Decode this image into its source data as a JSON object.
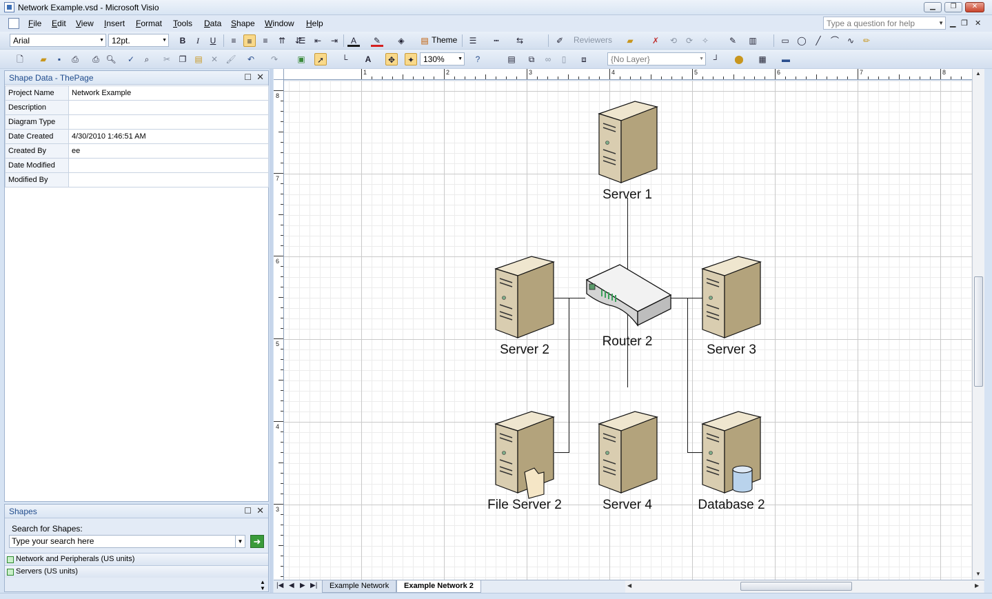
{
  "window": {
    "title": "Network Example.vsd - Microsoft Visio",
    "controls": {
      "minimize": "▁",
      "restore": "❐",
      "close": "✕"
    }
  },
  "menubar": {
    "items": [
      "File",
      "Edit",
      "View",
      "Insert",
      "Format",
      "Tools",
      "Data",
      "Shape",
      "Window",
      "Help"
    ],
    "help_placeholder": "Type a question for help"
  },
  "toolbar1": {
    "font": "Arial",
    "font_size": "12pt.",
    "theme_label": "Theme",
    "reviewers_label": "Reviewers"
  },
  "toolbar2": {
    "zoom": "130%",
    "layer": "{No Layer}"
  },
  "shape_data": {
    "title": "Shape Data - ThePage",
    "rows": [
      {
        "key": "Project Name",
        "value": "Network Example"
      },
      {
        "key": "Description",
        "value": ""
      },
      {
        "key": "Diagram Type",
        "value": ""
      },
      {
        "key": "Date Created",
        "value": "4/30/2010 1:46:51 AM"
      },
      {
        "key": "Created By",
        "value": "ee"
      },
      {
        "key": "Date Modified",
        "value": ""
      },
      {
        "key": "Modified By",
        "value": ""
      }
    ]
  },
  "shapes_panel": {
    "title": "Shapes",
    "search_label": "Search for Shapes:",
    "search_placeholder": "Type your search here",
    "stencils": [
      "Network and Peripherals (US units)",
      "Servers (US units)"
    ]
  },
  "rulers": {
    "top_labels": [
      "1",
      "2",
      "3",
      "4",
      "5",
      "6",
      "7",
      "8"
    ],
    "left_labels": [
      "8",
      "7",
      "6",
      "5",
      "4",
      "3"
    ]
  },
  "diagram": {
    "nodes": [
      {
        "id": "server1",
        "label": "Server 1",
        "type": "server"
      },
      {
        "id": "server2",
        "label": "Server 2",
        "type": "server"
      },
      {
        "id": "router2",
        "label": "Router 2",
        "type": "router"
      },
      {
        "id": "server3",
        "label": "Server 3",
        "type": "server"
      },
      {
        "id": "fileserver2",
        "label": "File Server 2",
        "type": "file-server"
      },
      {
        "id": "server4",
        "label": "Server 4",
        "type": "server"
      },
      {
        "id": "database2",
        "label": "Database 2",
        "type": "database-server"
      }
    ]
  },
  "page_tabs": {
    "tabs": [
      "Example Network",
      "Example Network 2"
    ],
    "active": "Example Network 2"
  },
  "colors": {
    "server_body": "#d9cdb0",
    "server_dark": "#a89a74",
    "router_body": "#e6e6e6",
    "accent": "#1f4b8c"
  }
}
